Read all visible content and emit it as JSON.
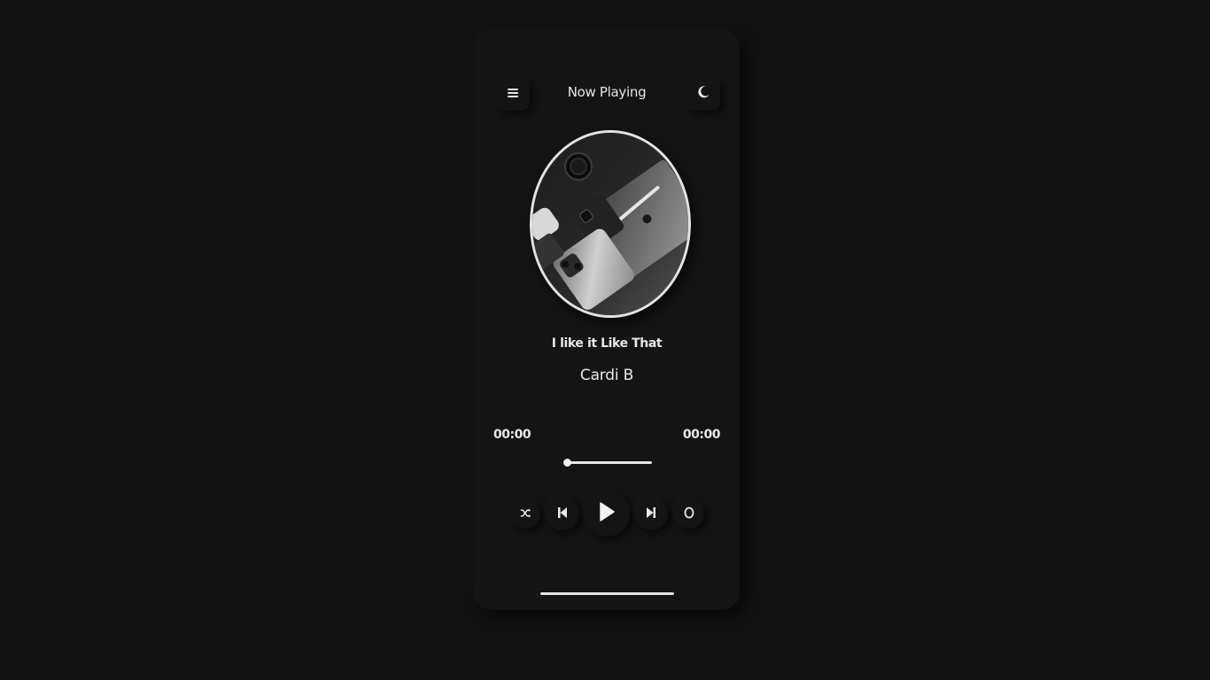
{
  "header": {
    "title": "Now Playing",
    "menu_icon": "hamburger-menu-icon",
    "theme_icon": "moon-icon"
  },
  "track": {
    "title": "I like it Like That",
    "artist": "Cardi B",
    "album_art": "apple-devices-photo"
  },
  "progress": {
    "current_time": "00:00",
    "total_time": "00:00",
    "fraction": 0
  },
  "controls": {
    "shuffle_icon": "shuffle-icon",
    "previous_icon": "skip-previous-icon",
    "play_icon": "play-icon",
    "next_icon": "skip-next-icon",
    "repeat_icon": "repeat-icon"
  },
  "colors": {
    "background": "#121212",
    "card": "#141414",
    "foreground": "#e8e8e8"
  }
}
